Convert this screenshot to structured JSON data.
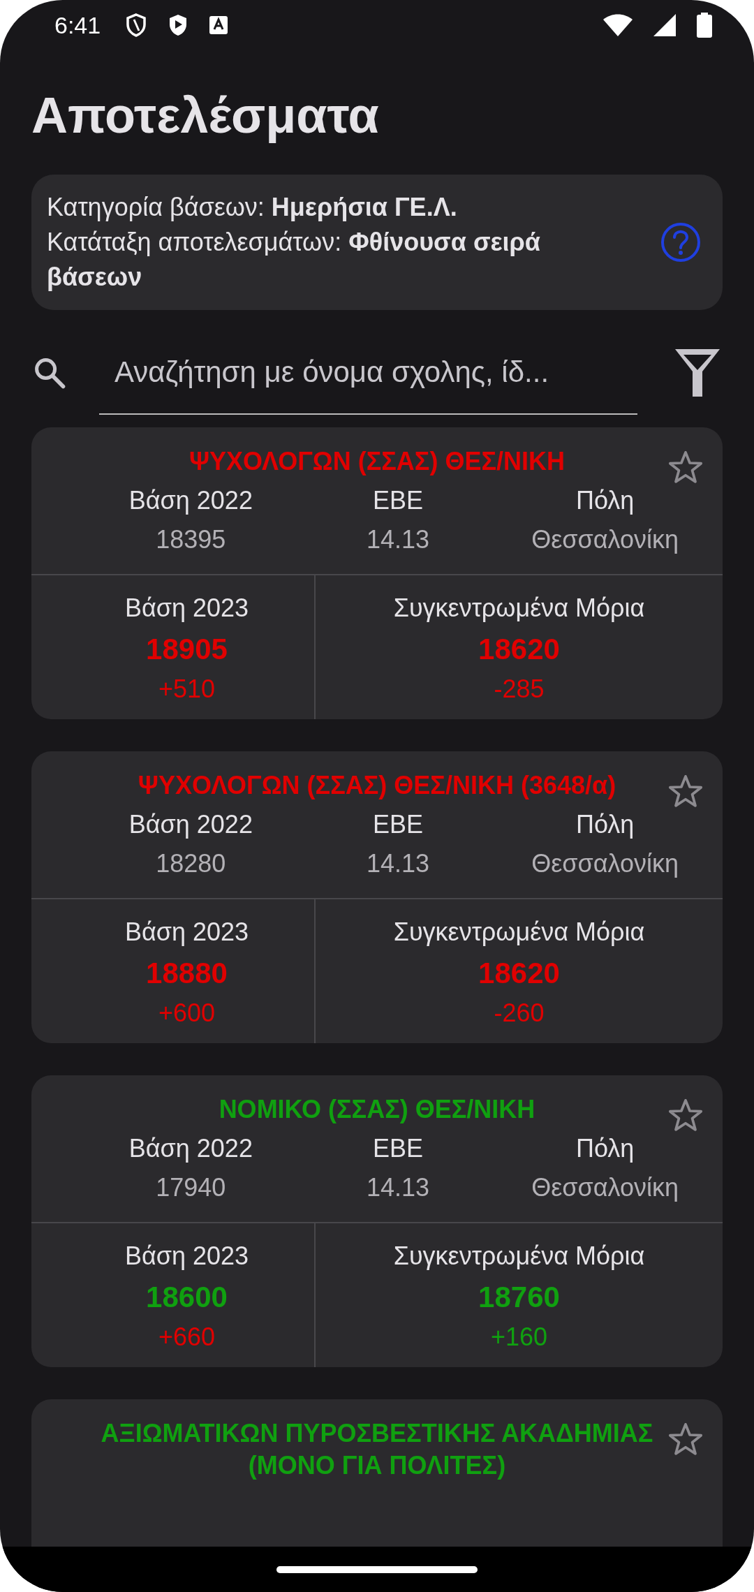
{
  "status_bar": {
    "time": "6:41"
  },
  "title": "Αποτελέσματα",
  "info": {
    "lines": [
      "Κατηγορία βάσεων: **Ημερήσια ΓΕ.Λ.**",
      "Κατάταξη αποτελεσμάτων: **Φθίνουσα σειρά βάσεων**"
    ]
  },
  "search": {
    "placeholder": "Αναζήτηση με όνομα σχολης, ίδ..."
  },
  "cards": [
    {
      "title": "ΨΥΧΟΛΟΓΩΝ (ΣΣΑΣ) ΘΕΣ/ΝΙΚΗ",
      "color": "#e00000",
      "favorite": false,
      "stats": [
        {
          "label": "Βάση 2022",
          "value": "18395"
        },
        {
          "label": "ΕΒΕ",
          "value": "14.13"
        },
        {
          "label": "Πόλη",
          "value": "Θεσσαλονίκη"
        }
      ],
      "results": [
        {
          "label": "Βάση 2023",
          "value": {
            "text": "18905",
            "color": "#e00000"
          },
          "change": {
            "text": "+510",
            "color": "#e00000"
          }
        },
        {
          "label": "Συγκεντρωμένα Μόρια",
          "value": {
            "text": "18620",
            "color": "#e00000"
          },
          "change": {
            "text": "-285",
            "color": "#e00000"
          }
        }
      ]
    },
    {
      "title": "ΨΥΧΟΛΟΓΩΝ (ΣΣΑΣ) ΘΕΣ/ΝΙΚΗ (3648/α)",
      "color": "#e00000",
      "favorite": false,
      "stats": [
        {
          "label": "Βάση 2022",
          "value": "18280"
        },
        {
          "label": "ΕΒΕ",
          "value": "14.13"
        },
        {
          "label": "Πόλη",
          "value": "Θεσσαλονίκη"
        }
      ],
      "results": [
        {
          "label": "Βάση 2023",
          "value": {
            "text": "18880",
            "color": "#e00000"
          },
          "change": {
            "text": "+600",
            "color": "#e00000"
          }
        },
        {
          "label": "Συγκεντρωμένα Μόρια",
          "value": {
            "text": "18620",
            "color": "#e00000"
          },
          "change": {
            "text": "-260",
            "color": "#e00000"
          }
        }
      ]
    },
    {
      "title": "ΝΟΜΙΚΟ (ΣΣΑΣ) ΘΕΣ/ΝΙΚΗ",
      "color": "#10a010",
      "favorite": false,
      "stats": [
        {
          "label": "Βάση 2022",
          "value": "17940"
        },
        {
          "label": "ΕΒΕ",
          "value": "14.13"
        },
        {
          "label": "Πόλη",
          "value": "Θεσσαλονίκη"
        }
      ],
      "results": [
        {
          "label": "Βάση 2023",
          "value": {
            "text": "18600",
            "color": "#10a010"
          },
          "change": {
            "text": "+660",
            "color": "#e00000"
          }
        },
        {
          "label": "Συγκεντρωμένα Μόρια",
          "value": {
            "text": "18760",
            "color": "#10a010"
          },
          "change": {
            "text": "+160",
            "color": "#10a010"
          }
        }
      ]
    },
    {
      "title": "ΑΞΙΩΜΑΤΙΚΩΝ ΠΥΡΟΣΒΕΣΤΙΚΗΣ ΑΚΑΔΗΜΙΑΣ (ΜΟΝΟ ΓΙΑ ΠΟΛΙΤΕΣ)",
      "color": "#10a010",
      "favorite": false
    }
  ]
}
